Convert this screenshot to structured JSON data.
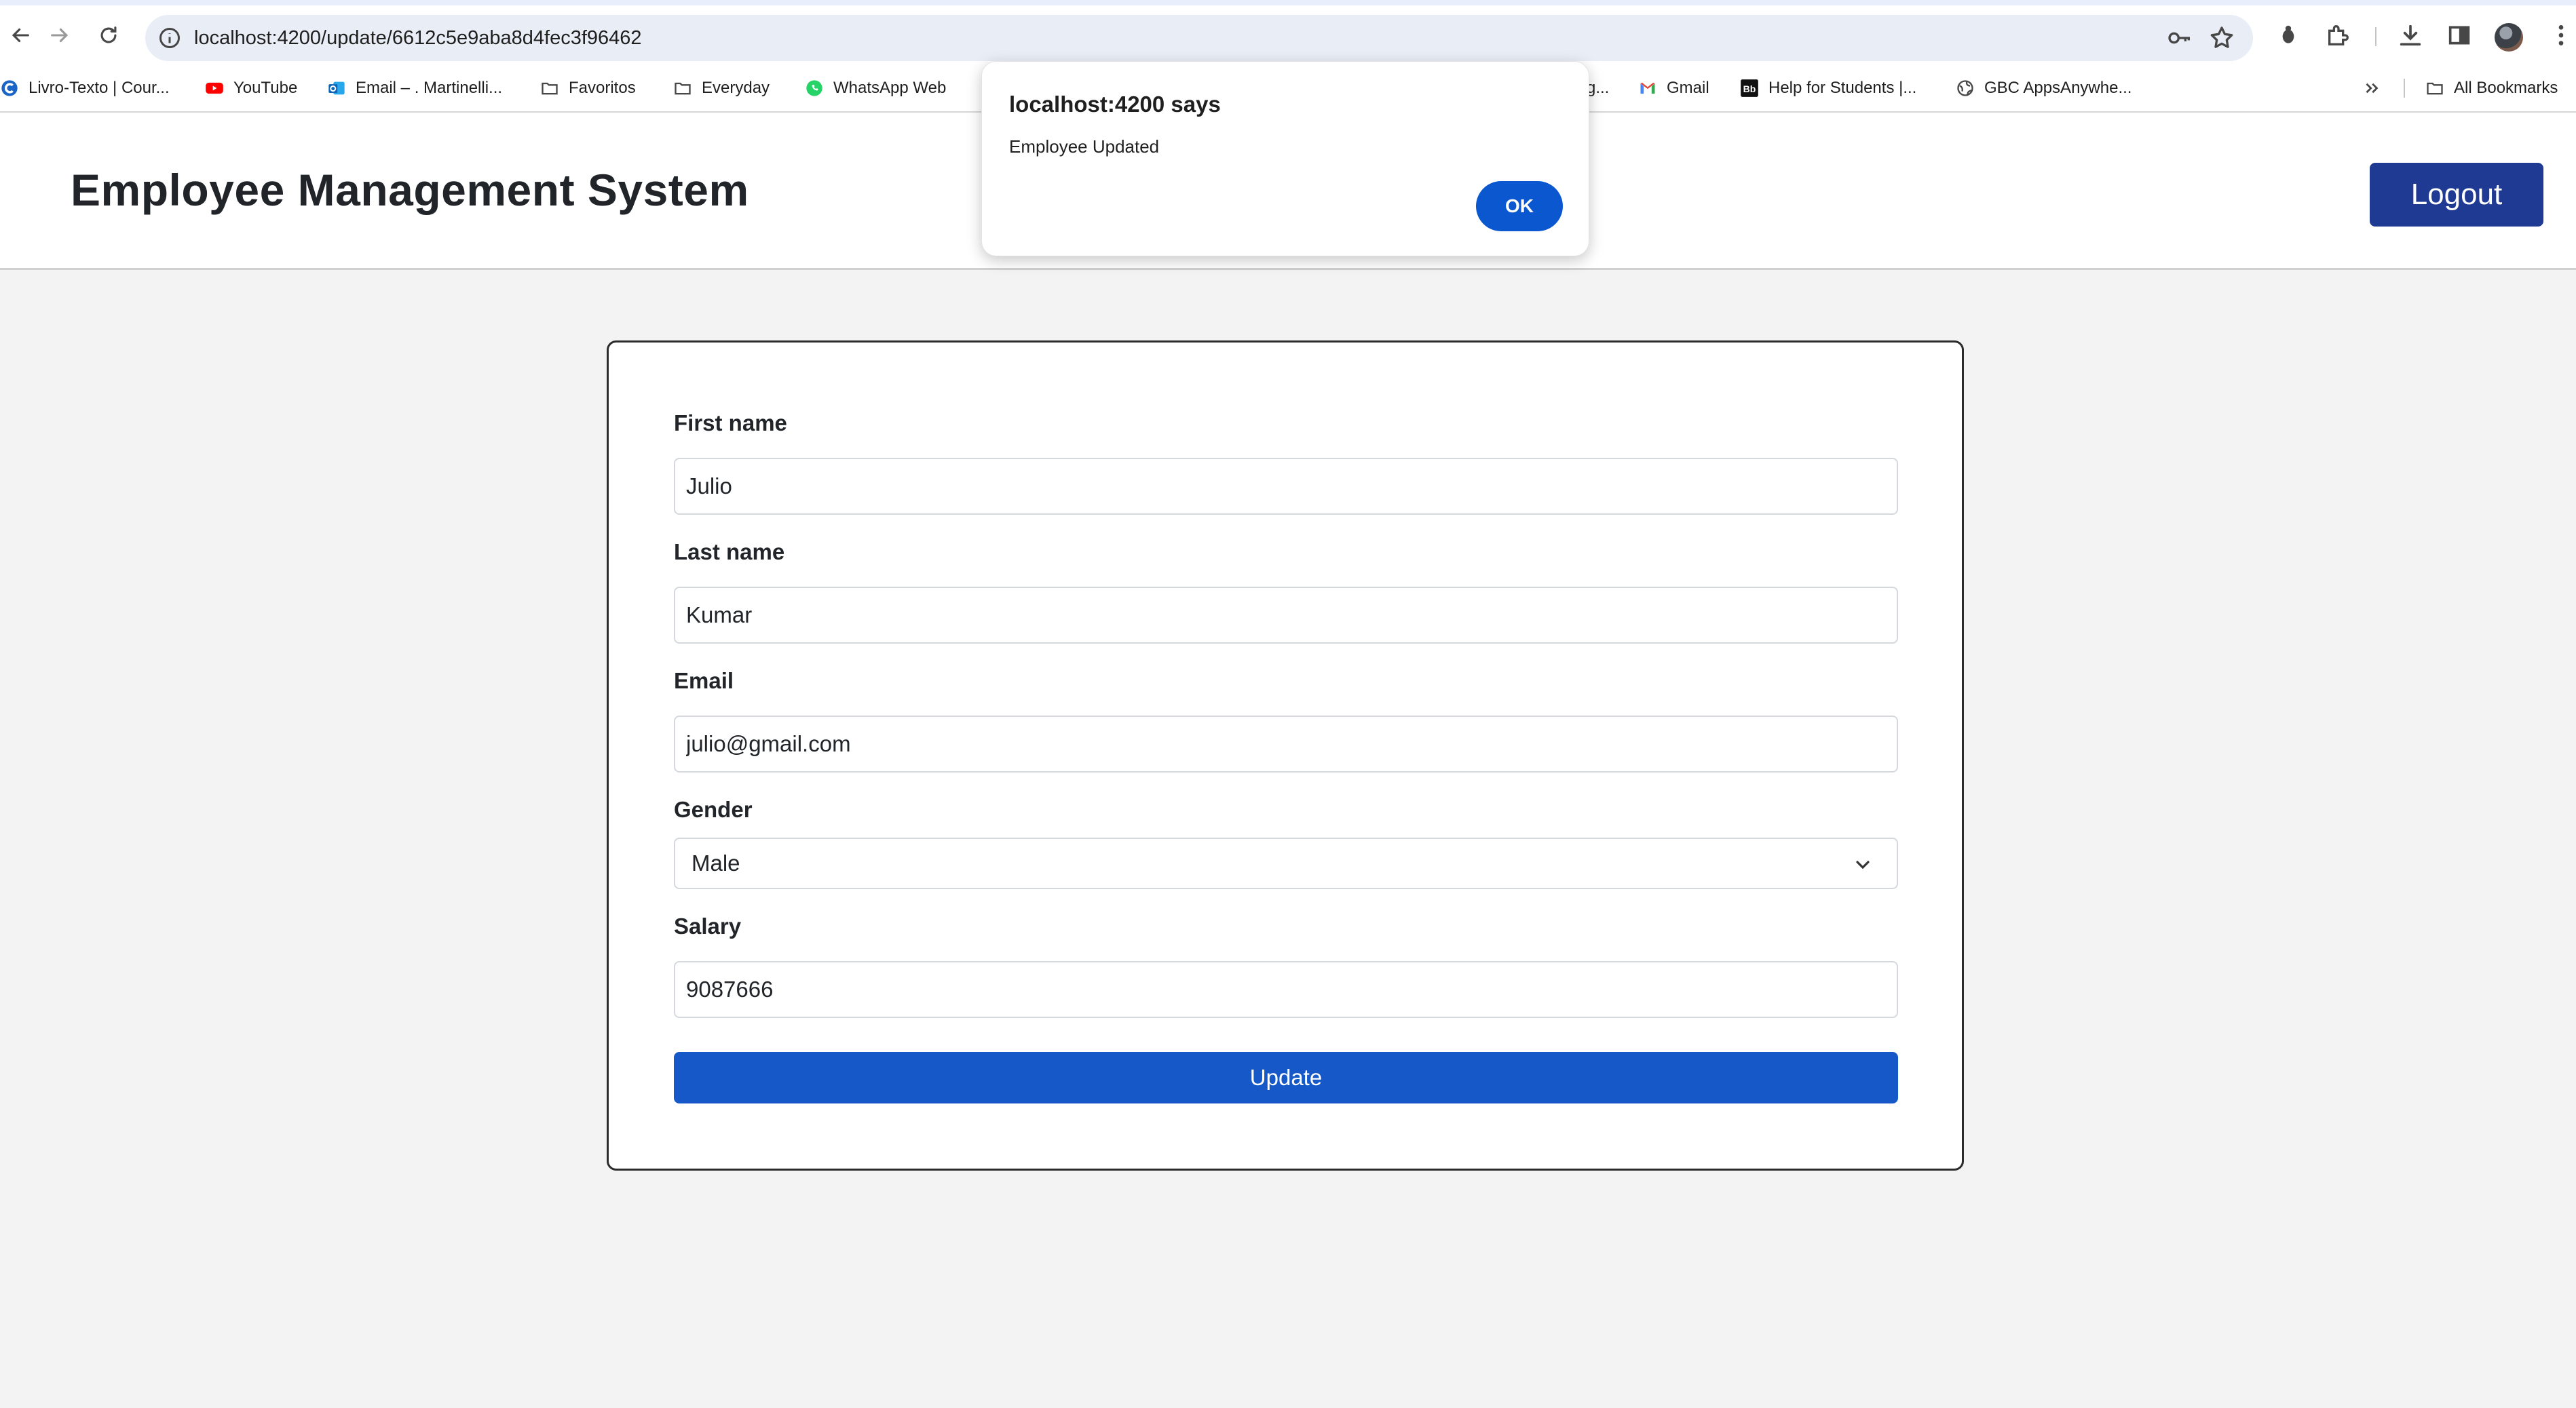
{
  "browser": {
    "url": "localhost:4200/update/6612c5e9aba8d4fec3f96462",
    "bookmarks": [
      {
        "label": "Livro-Texto | Cour...",
        "icon": "course-icon"
      },
      {
        "label": "YouTube",
        "icon": "youtube-icon"
      },
      {
        "label": "Email – . Martinelli...",
        "icon": "outlook-icon"
      },
      {
        "label": "Favoritos",
        "icon": "folder-icon"
      },
      {
        "label": "Everyday",
        "icon": "folder-icon"
      },
      {
        "label": "WhatsApp Web",
        "icon": "whatsapp-icon"
      },
      {
        "label": "g...",
        "icon": ""
      },
      {
        "label": "Gmail",
        "icon": "gmail-icon"
      },
      {
        "label": "Help for Students |...",
        "icon": "blackboard-icon"
      },
      {
        "label": "GBC AppsAnywhe...",
        "icon": "globe-icon"
      },
      {
        "label": "All Bookmarks",
        "icon": "folder-icon"
      }
    ],
    "bb_glyph": "Bb",
    "colors": {
      "omnibox": "#e9edf6",
      "youtube": "#ff0000",
      "whatsapp": "#25d366"
    }
  },
  "app": {
    "title": "Employee Management System",
    "logout_label": "Logout"
  },
  "form": {
    "first_name": {
      "label": "First name",
      "value": "Julio"
    },
    "last_name": {
      "label": "Last name",
      "value": "Kumar"
    },
    "email": {
      "label": "Email",
      "value": "julio@gmail.com"
    },
    "gender": {
      "label": "Gender",
      "value": "Male"
    },
    "salary": {
      "label": "Salary",
      "value": "9087666"
    },
    "submit_label": "Update"
  },
  "dialog": {
    "title": "localhost:4200 says",
    "message": "Employee Updated",
    "ok_label": "OK"
  },
  "colors": {
    "logout": "#1f3a93",
    "update": "#1758c9",
    "dialog_ok": "#0b57d0"
  }
}
